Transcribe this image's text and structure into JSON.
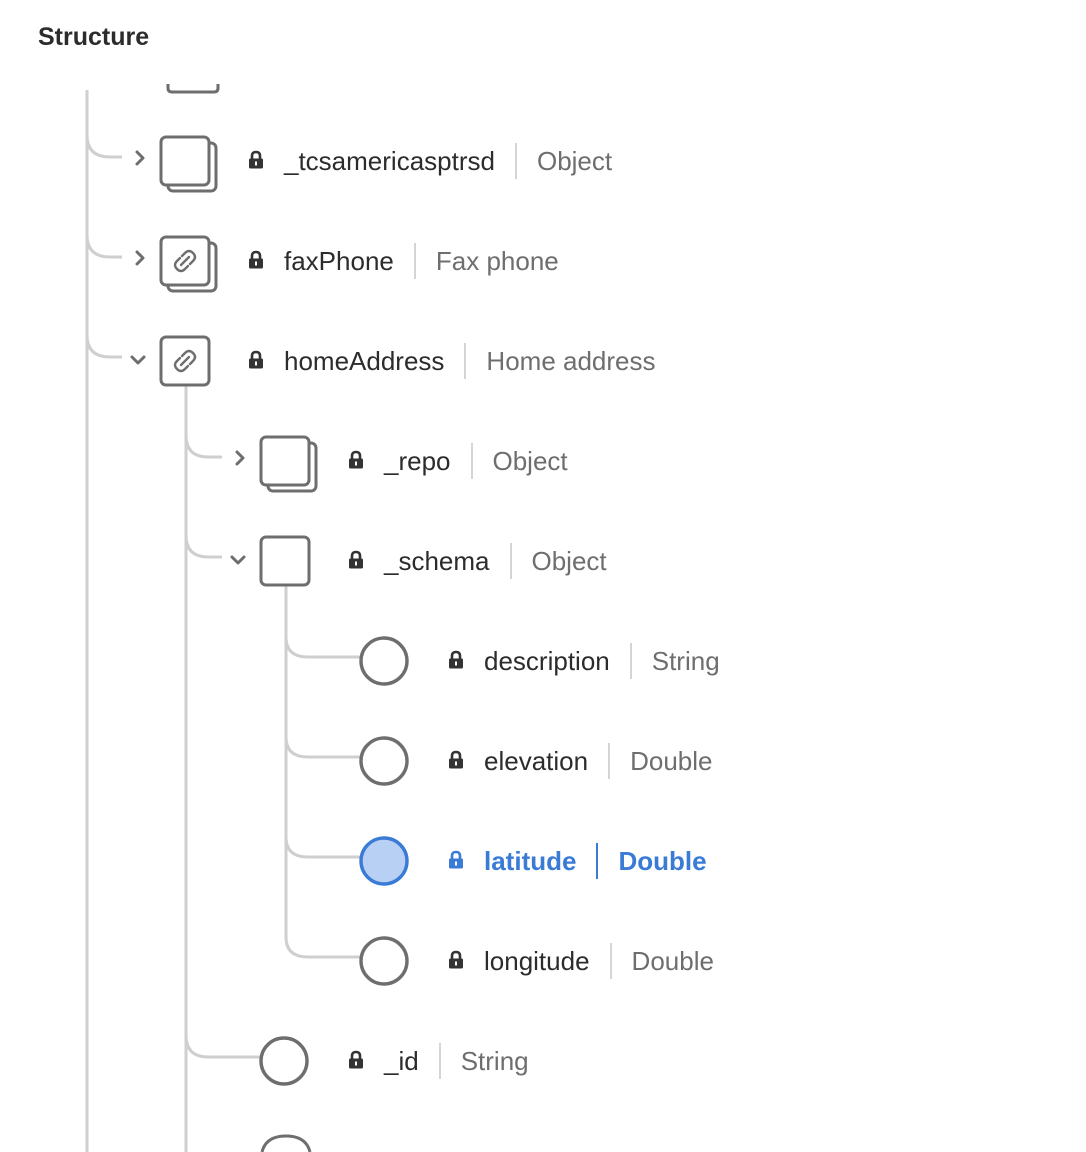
{
  "panel": {
    "title": "Structure"
  },
  "colors": {
    "line": "#cfcfcf",
    "icon_stroke": "#6e6e6e",
    "selected_accent": "#3a7bd5",
    "selected_fill": "#b8d0f3"
  },
  "nodes": [
    {
      "name": "_tcsamericasptrsd",
      "type": "Object",
      "icon": "object-array-icon",
      "expander": "chevron-right-icon"
    },
    {
      "name": "faxPhone",
      "type": "Fax phone",
      "icon": "link-array-icon",
      "expander": "chevron-right-icon"
    },
    {
      "name": "homeAddress",
      "type": "Home address",
      "icon": "link-object-icon",
      "expander": "chevron-down-icon"
    },
    {
      "name": "_repo",
      "type": "Object",
      "icon": "object-array-icon",
      "expander": "chevron-right-icon"
    },
    {
      "name": "_schema",
      "type": "Object",
      "icon": "object-icon",
      "expander": "chevron-down-icon"
    },
    {
      "name": "description",
      "type": "String",
      "icon": "field-circle-icon"
    },
    {
      "name": "elevation",
      "type": "Double",
      "icon": "field-circle-icon"
    },
    {
      "name": "latitude",
      "type": "Double",
      "icon": "field-circle-icon",
      "selected": true
    },
    {
      "name": "longitude",
      "type": "Double",
      "icon": "field-circle-icon"
    },
    {
      "name": "_id",
      "type": "String",
      "icon": "field-circle-icon"
    }
  ]
}
